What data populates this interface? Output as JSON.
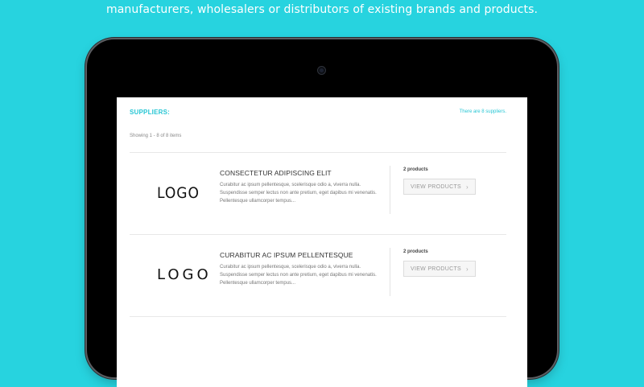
{
  "headline": "manufacturers, wholesalers or distributors of existing brands and products.",
  "colors": {
    "background": "#27d3df",
    "accent": "#27c6d4",
    "tablet_bezel": "#000000"
  },
  "page": {
    "title": "SUPPLIERS:",
    "count_text": "There are 8 suppliers.",
    "showing_text": "Showing 1 - 8 of 8 items"
  },
  "suppliers": [
    {
      "logo_text": "LOGO",
      "name": "CONSECTETUR ADIPISCING ELIT",
      "desc": "Curabitur ac ipsum pellentesque, scelerisque odio a, viverra nulla. Suspendisse semper lectus non ante pretium, eget dapibus mi venenatis. Pellentesque ullamcorper tempus...",
      "products": "2 products",
      "button": "VIEW PRODUCTS",
      "button_icon": "chevron-right-icon"
    },
    {
      "logo_text": "LOGO",
      "name": "CURABITUR AC IPSUM PELLENTESQUE",
      "desc": "Curabitur ac ipsum pellentesque, scelerisque odio a, viverra nulla. Suspendisse semper lectus non ante pretium, eget dapibus mi venenatis. Pellentesque ullamcorper tempus...",
      "products": "2 products",
      "button": "VIEW PRODUCTS",
      "button_icon": "chevron-right-icon"
    }
  ]
}
